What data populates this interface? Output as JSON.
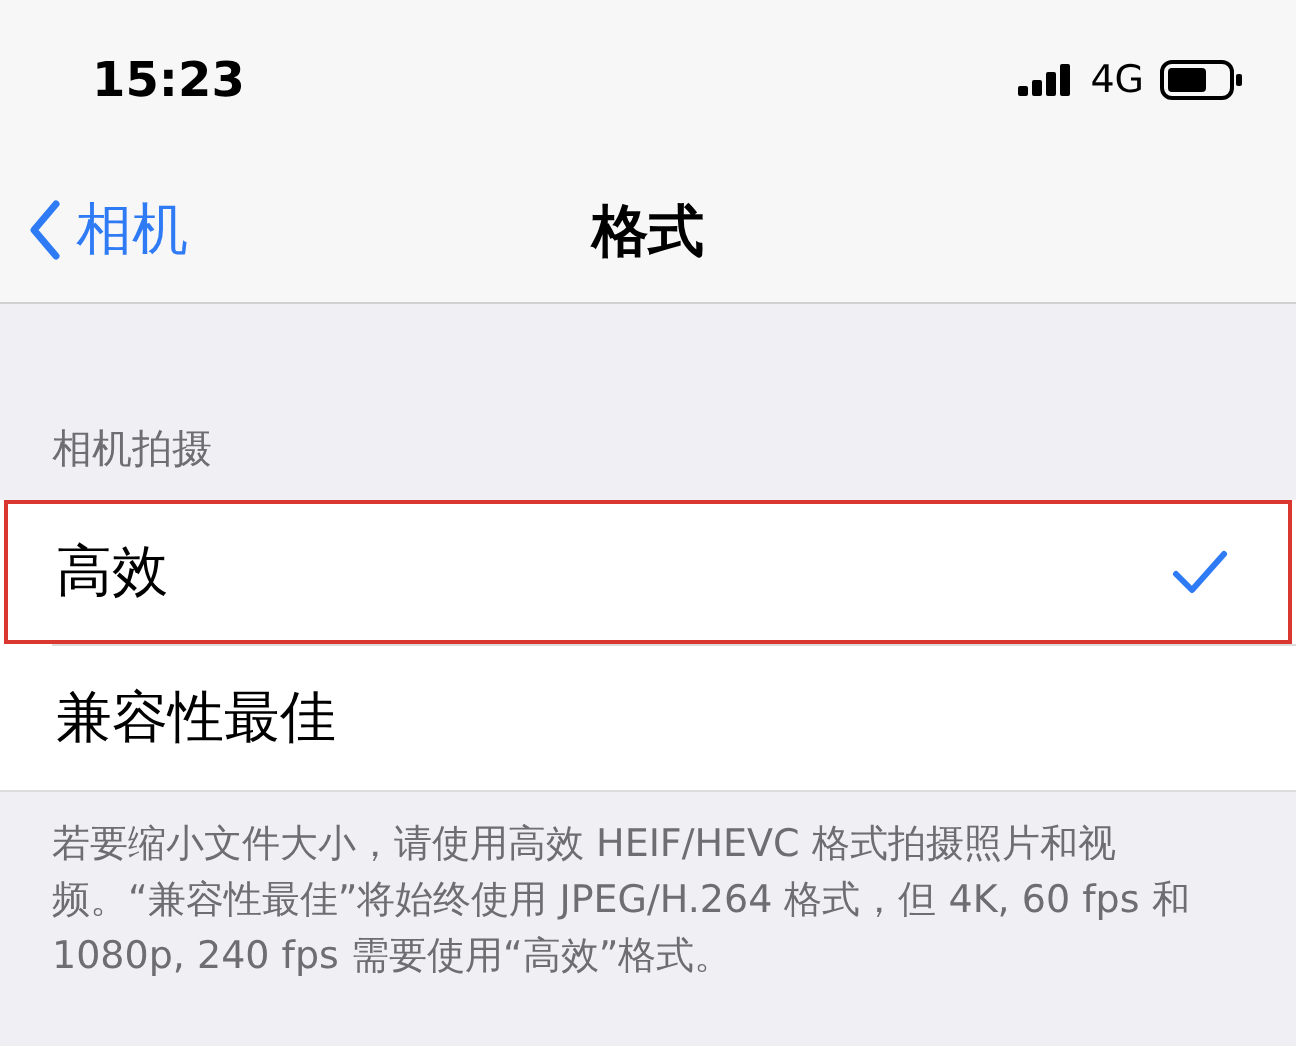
{
  "status_bar": {
    "time": "15:23",
    "network": "4G"
  },
  "nav": {
    "back": "相机",
    "title": "格式"
  },
  "section": {
    "header": "相机拍摄",
    "options": [
      {
        "label": "高效",
        "selected": true,
        "highlighted": true
      },
      {
        "label": "兼容性最佳",
        "selected": false,
        "highlighted": false
      }
    ],
    "footer": "若要缩小文件大小，请使用高效 HEIF/HEVC 格式拍摄照片和视频。“兼容性最佳”将始终使用 JPEG/H.264 格式，但 4K, 60 fps 和1080p, 240 fps 需要使用“高效”格式。"
  }
}
